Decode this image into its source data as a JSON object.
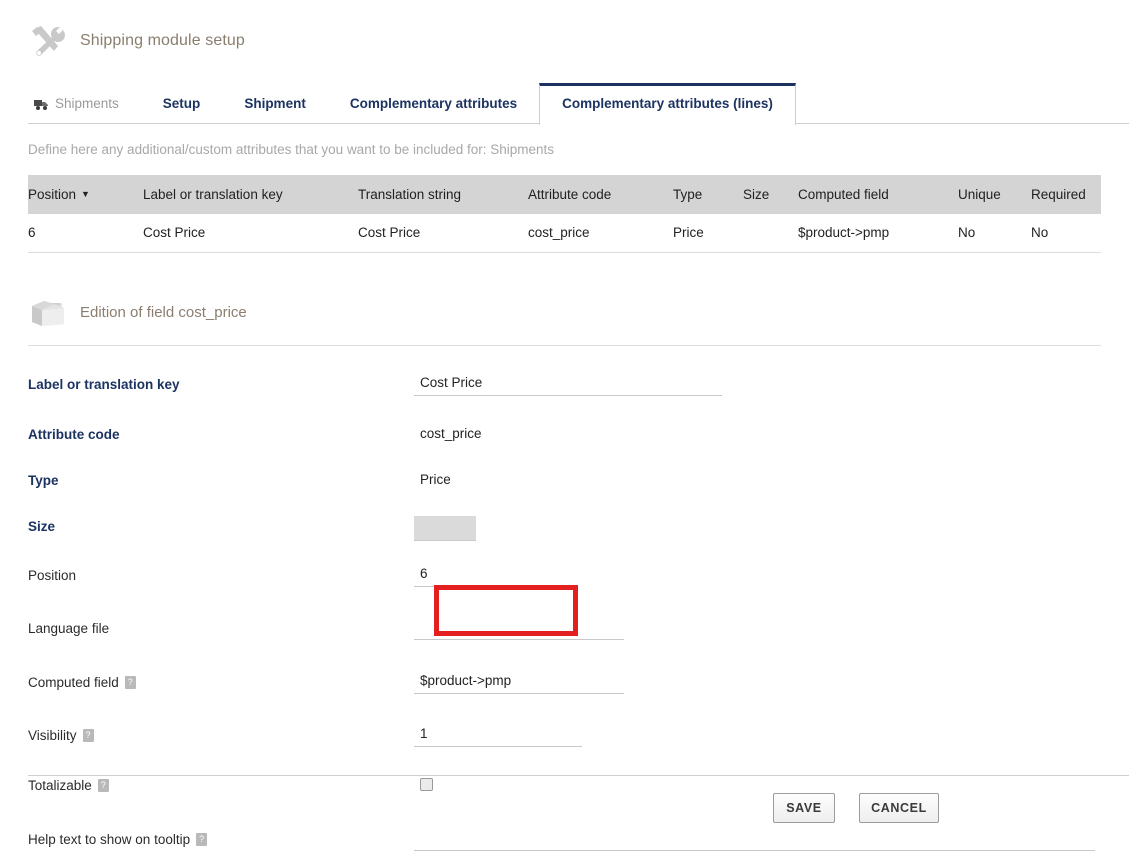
{
  "header": {
    "title": "Shipping module setup",
    "icon": "tools-icon"
  },
  "tabs": [
    {
      "label": "Shipments",
      "state": "muted",
      "icon": "truck-icon"
    },
    {
      "label": "Setup",
      "state": "normal"
    },
    {
      "label": "Shipment",
      "state": "normal"
    },
    {
      "label": "Complementary attributes",
      "state": "normal"
    },
    {
      "label": "Complementary attributes (lines)",
      "state": "active"
    }
  ],
  "description": "Define here any additional/custom attributes that you want to be included for: Shipments",
  "table": {
    "columns": [
      "Position",
      "Label or translation key",
      "Translation string",
      "Attribute code",
      "Type",
      "Size",
      "Computed field",
      "Unique",
      "Required"
    ],
    "sort_column": "Position",
    "sort_direction": "desc",
    "rows": [
      {
        "position": "6",
        "label": "Cost Price",
        "translation_string": "Cost Price",
        "attribute_code": "cost_price",
        "type": "Price",
        "size": "",
        "computed_field": "$product->pmp",
        "unique": "No",
        "required": "No"
      }
    ]
  },
  "edit_section": {
    "title": "Edition of field cost_price",
    "icon": "folder-icon",
    "fields": {
      "label_key": {
        "label": "Label or translation key",
        "value": "Cost Price",
        "required": true
      },
      "attribute_code": {
        "label": "Attribute code",
        "value": "cost_price",
        "required": true
      },
      "type": {
        "label": "Type",
        "value": "Price",
        "required": true
      },
      "size": {
        "label": "Size",
        "value": "",
        "required": true
      },
      "position": {
        "label": "Position",
        "value": "6",
        "required": false
      },
      "language_file": {
        "label": "Language file",
        "value": "",
        "required": false
      },
      "computed_field": {
        "label": "Computed field",
        "value": "$product->pmp",
        "required": false,
        "help": "?"
      },
      "visibility": {
        "label": "Visibility",
        "value": "1",
        "required": false,
        "help": "?"
      },
      "totalizable": {
        "label": "Totalizable",
        "value": "",
        "checked": false,
        "required": false,
        "help": "?"
      },
      "help_text": {
        "label": "Help text to show on tooltip",
        "value": "",
        "required": false,
        "help": "?"
      }
    }
  },
  "footer": {
    "save_label": "SAVE",
    "cancel_label": "CANCEL"
  },
  "annotation": {
    "type": "red-rectangle",
    "color": "#e41f20",
    "targets": "computed-field-input"
  }
}
